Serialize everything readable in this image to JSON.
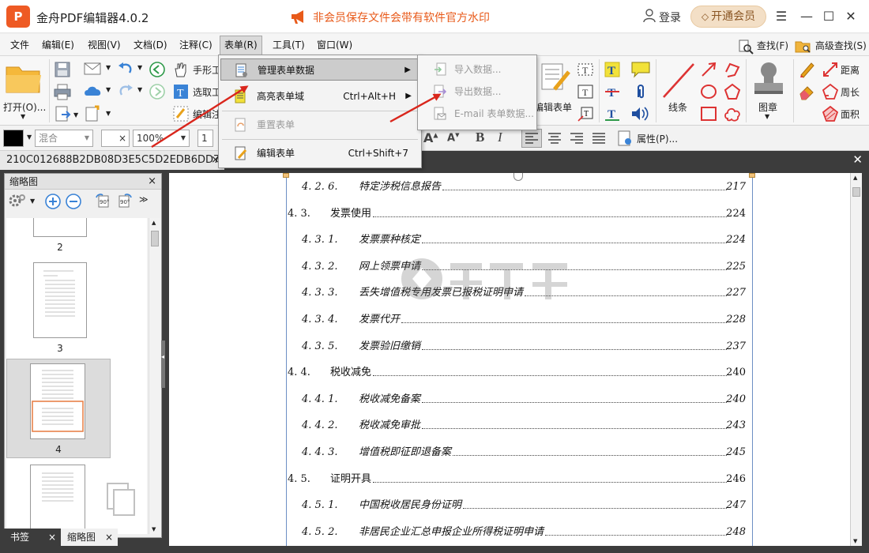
{
  "window": {
    "app_title": "金舟PDF编辑器4.0.2",
    "logo_letter": "P",
    "promo_text": "非会员保存文件会带有软件官方水印",
    "login_label": "登录",
    "member_label": "开通会员"
  },
  "menubar": {
    "items": [
      "文件",
      "编辑(E)",
      "视图(V)",
      "文档(D)",
      "注释(C)",
      "表单(R)",
      "工具(T)",
      "窗口(W)"
    ],
    "active_index": 5,
    "find_label": "查找(F)",
    "advanced_find_label": "高级查找(S)"
  },
  "ribbon": {
    "open_label": "打开(O)...",
    "hand_tool_label": "手形工",
    "select_tool_label": "选取工",
    "edit_note_label": "编辑注",
    "edit_form_label": "编辑表单",
    "line_label": "线条",
    "stamp_label": "图章",
    "distance_label": "距离",
    "perimeter_label": "周长",
    "area_label": "面积",
    "properties_label": "属性(P)..."
  },
  "format_bar": {
    "blend_label": "混合",
    "zoom_value": "100%",
    "line_width_value": "1"
  },
  "tabs": {
    "doc_tab_label": "210C012688B2DB08D3E5C5D2EDB6DD74"
  },
  "thumbnail_panel": {
    "title": "缩略图",
    "pages": [
      "2",
      "3",
      "4"
    ],
    "selected_page": "4",
    "bookmark_tab": "书签",
    "thumbnail_tab": "缩略图"
  },
  "form_menu": {
    "items": [
      {
        "label": "管理表单数据",
        "shortcut": "",
        "has_submenu": true,
        "highlighted": true,
        "disabled": false
      },
      {
        "label": "高亮表单域",
        "shortcut": "Ctrl+Alt+H",
        "has_submenu": true,
        "highlighted": false,
        "disabled": false
      },
      {
        "label": "重置表单",
        "shortcut": "",
        "has_submenu": false,
        "highlighted": false,
        "disabled": true
      },
      {
        "label": "编辑表单",
        "shortcut": "Ctrl+Shift+7",
        "has_submenu": false,
        "highlighted": false,
        "disabled": false
      }
    ],
    "submenu_items": [
      "导入数据...",
      "导出数据...",
      "E-mail 表单数据..."
    ]
  },
  "document": {
    "toc": [
      {
        "num": "4. 2. 6.",
        "text": "特定涉税信息报告",
        "page": "217",
        "level": 2
      },
      {
        "num": "4. 3.",
        "text": "发票使用",
        "page": "224",
        "level": 1
      },
      {
        "num": "4. 3. 1.",
        "text": "发票票种核定",
        "page": "224",
        "level": 2
      },
      {
        "num": "4. 3. 2.",
        "text": "网上领票申请",
        "page": "225",
        "level": 2
      },
      {
        "num": "4. 3. 3.",
        "text": "丢失增值税专用发票已报税证明申请",
        "page": "227",
        "level": 2
      },
      {
        "num": "4. 3. 4.",
        "text": "发票代开",
        "page": "228",
        "level": 2
      },
      {
        "num": "4. 3. 5.",
        "text": "发票验旧缴销",
        "page": "237",
        "level": 2
      },
      {
        "num": "4. 4.",
        "text": "税收减免",
        "page": "240",
        "level": 1
      },
      {
        "num": "4. 4. 1.",
        "text": "税收减免备案",
        "page": "240",
        "level": 2
      },
      {
        "num": "4. 4. 2.",
        "text": "税收减免审批",
        "page": "243",
        "level": 2
      },
      {
        "num": "4. 4. 3.",
        "text": "增值税即征即退备案",
        "page": "245",
        "level": 2
      },
      {
        "num": "4. 5.",
        "text": "证明开具",
        "page": "246",
        "level": 1
      },
      {
        "num": "4. 5. 1.",
        "text": "中国税收居民身份证明",
        "page": "247",
        "level": 2
      },
      {
        "num": "4. 5. 2.",
        "text": "非居民企业汇总申报企业所得税证明申请",
        "page": "248",
        "level": 2
      }
    ]
  },
  "colors": {
    "accent": "#ee5a24",
    "promo": "#e85a1a",
    "member_bg": "#f3dfc6",
    "dark_bg": "#3c3c3c",
    "annotation_arrow": "#d9261c"
  }
}
